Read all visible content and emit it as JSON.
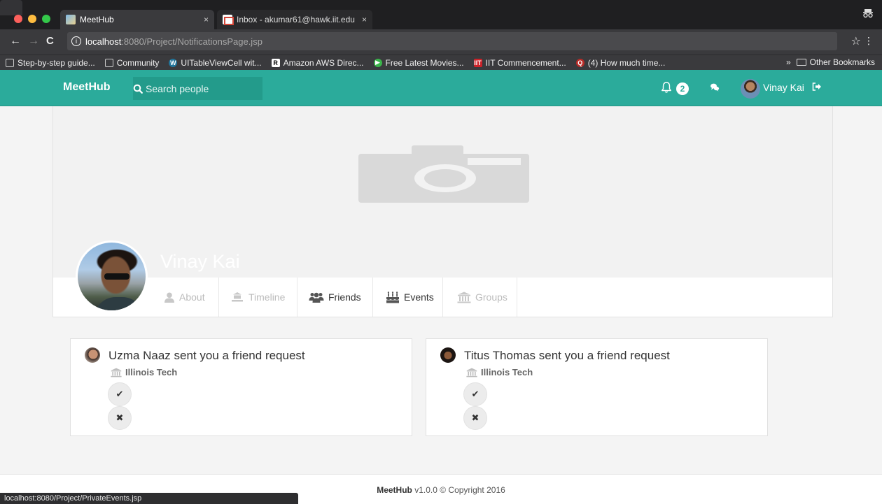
{
  "browser": {
    "tabs": [
      {
        "title": "MeetHub",
        "close": "×"
      },
      {
        "title": "Inbox - akumar61@hawk.iit.edu",
        "close": "×"
      }
    ],
    "url_host": "localhost",
    "url_path": ":8080/Project/NotificationsPage.jsp",
    "bookmarks": [
      {
        "label": "Step-by-step guide...",
        "icon": "page-icon"
      },
      {
        "label": "Community",
        "icon": "page-icon"
      },
      {
        "label": "UITableViewCell wit...",
        "icon": "wordpress-icon"
      },
      {
        "label": "Amazon AWS Direc...",
        "icon": "r-icon"
      },
      {
        "label": "Free Latest Movies...",
        "icon": "play-icon"
      },
      {
        "label": "IIT Commencement...",
        "icon": "iit-icon"
      },
      {
        "label": "(4) How much time...",
        "icon": "quora-icon"
      }
    ],
    "bookmarks_overflow": "»",
    "other_bookmarks": "Other Bookmarks",
    "status_url": "localhost:8080/Project/PrivateEvents.jsp"
  },
  "navbar": {
    "brand": "MeetHub",
    "search_placeholder": "Search people",
    "notification_count": "2",
    "user_name": "Vinay Kai",
    "accent_color": "#2bab9b"
  },
  "profile": {
    "name": "Vinay Kai",
    "tabs": [
      {
        "label": "About",
        "icon": "user-icon",
        "active": false
      },
      {
        "label": "Timeline",
        "icon": "timeline-icon",
        "active": false
      },
      {
        "label": "Friends",
        "icon": "users-icon",
        "active": true
      },
      {
        "label": "Events",
        "icon": "birthday-cake-icon",
        "active": true
      },
      {
        "label": "Groups",
        "icon": "institution-icon",
        "active": false
      }
    ]
  },
  "notifications": [
    {
      "text": "Uzma Naaz sent you a friend request",
      "school": "Illinois Tech",
      "accept": "✔",
      "reject": "✖"
    },
    {
      "text": "Titus Thomas sent you a friend request",
      "school": "Illinois Tech",
      "accept": "✔",
      "reject": "✖"
    }
  ],
  "footer": {
    "brand": "MeetHub",
    "text": " v1.0.0 © Copyright 2016"
  }
}
